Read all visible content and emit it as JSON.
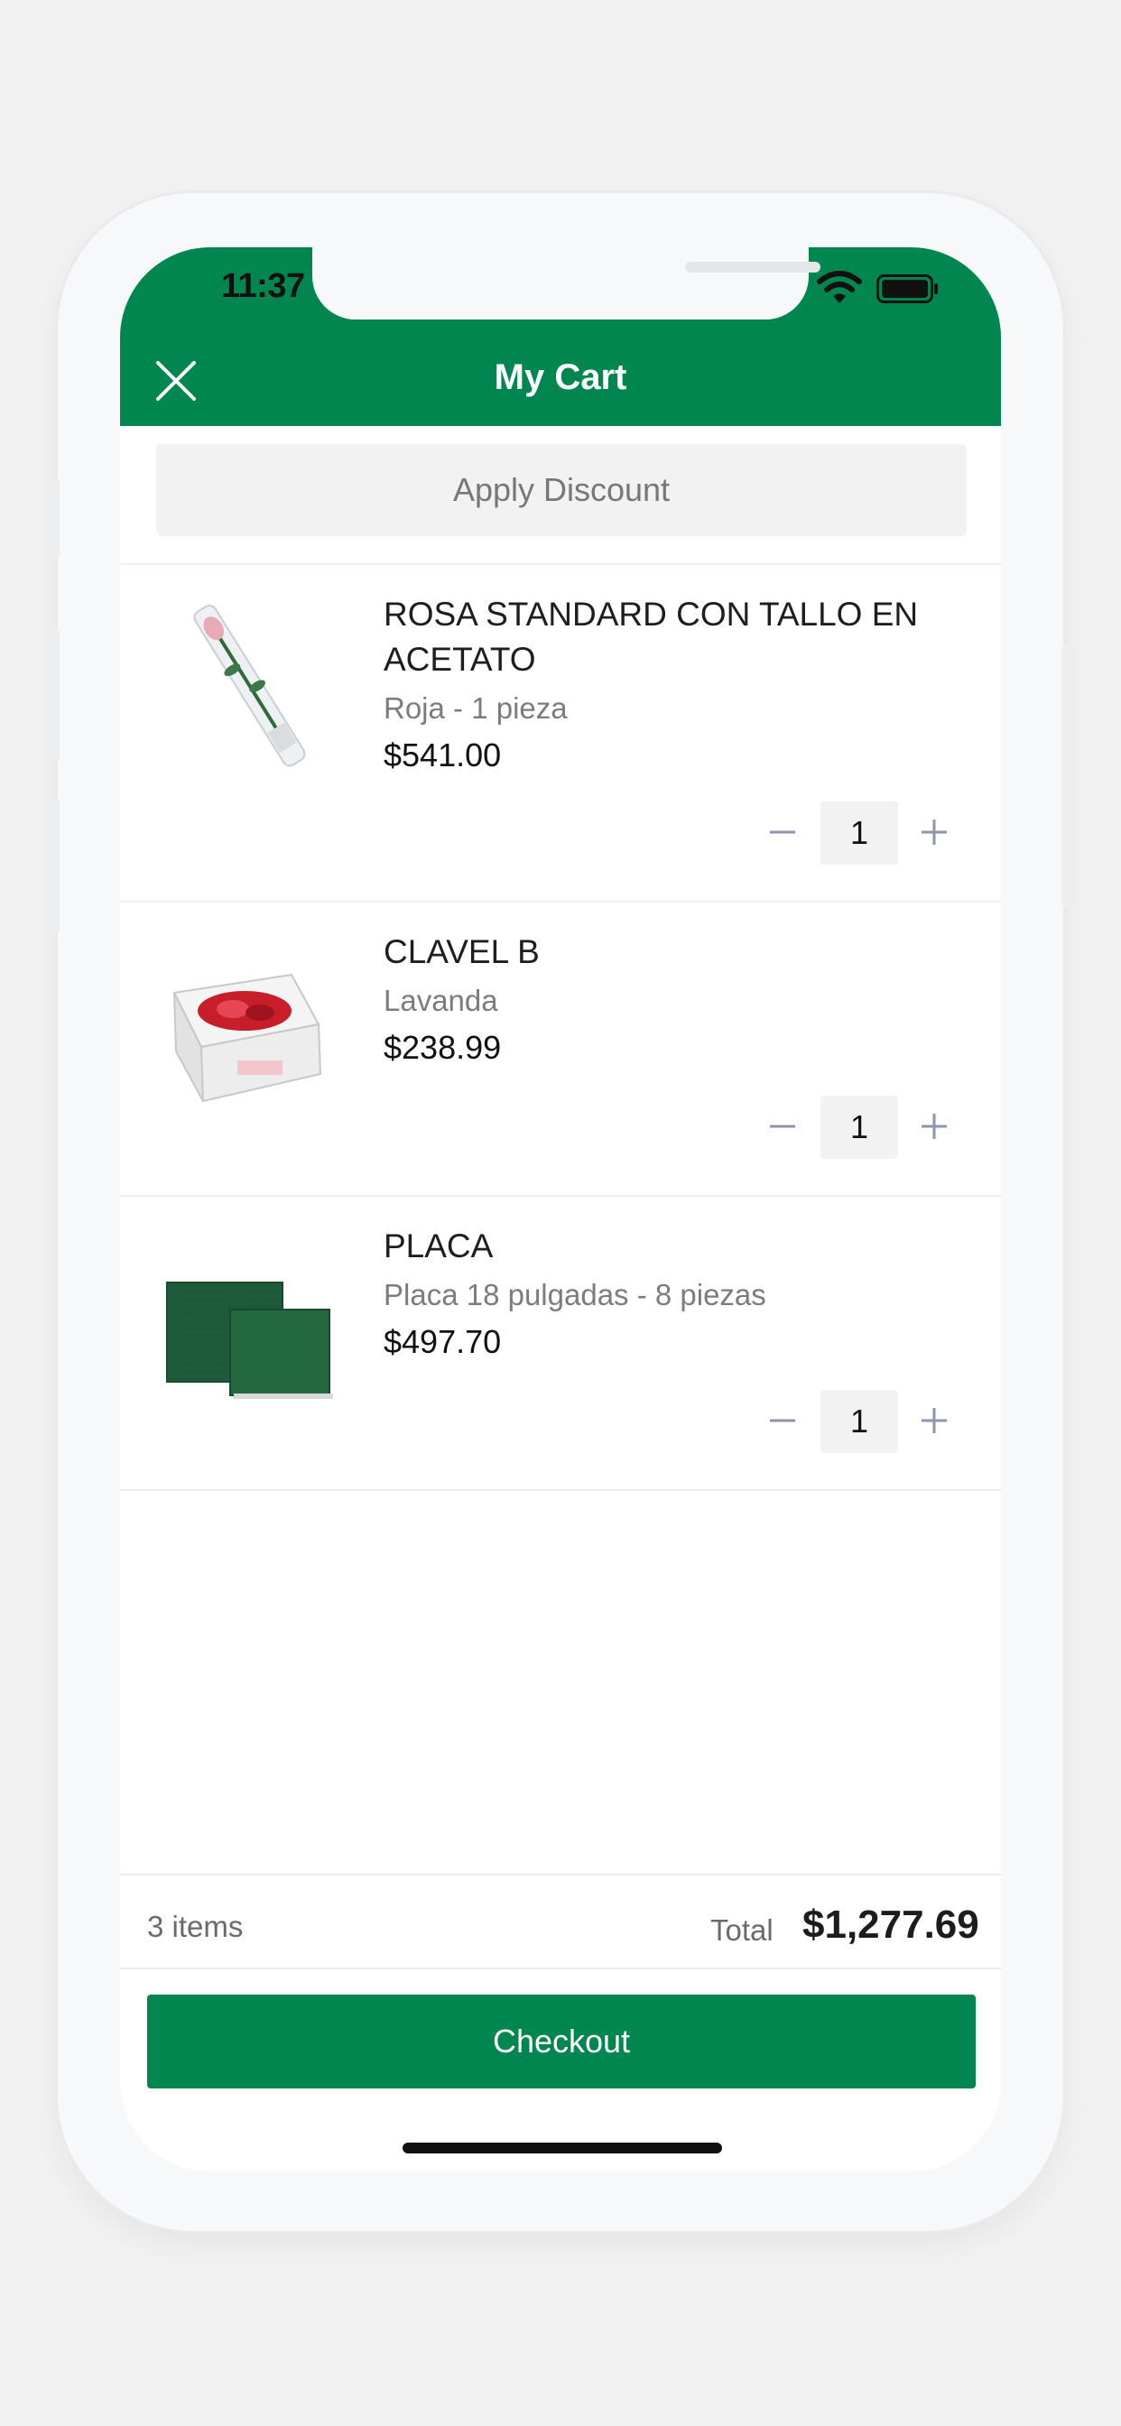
{
  "status_bar": {
    "time": "11:37"
  },
  "header": {
    "title": "My Cart",
    "close_icon": "close-icon"
  },
  "discount": {
    "label": "Apply Discount"
  },
  "cart_items": [
    {
      "name": "ROSA STANDARD CON TALLO EN ACETATO",
      "variant": "Roja - 1 pieza",
      "price": "$541.00",
      "quantity": "1"
    },
    {
      "name": "CLAVEL B",
      "variant": "Lavanda",
      "price": "$238.99",
      "quantity": "1"
    },
    {
      "name": "PLACA",
      "variant": "Placa 18 pulgadas - 8 piezas",
      "price": "$497.70",
      "quantity": "1"
    }
  ],
  "summary": {
    "items_count": "3 items",
    "total_label": "Total",
    "total_value": "$1,277.69"
  },
  "checkout": {
    "label": "Checkout"
  },
  "colors": {
    "brand": "#028650",
    "qty_icon": "#8e95ad"
  }
}
